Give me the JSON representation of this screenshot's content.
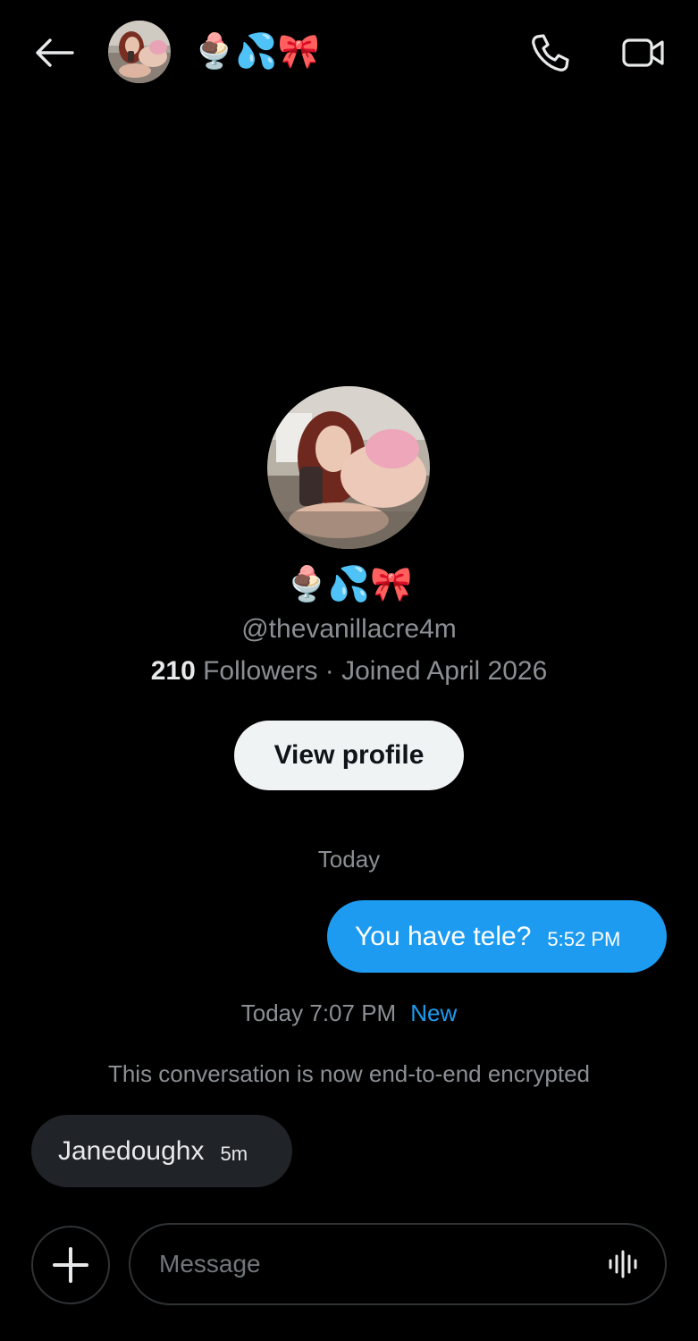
{
  "header": {
    "back_icon": "arrow-left-icon",
    "display_name": "🍨💦🎀",
    "call_icon": "phone-icon",
    "video_icon": "video-camera-icon"
  },
  "profile": {
    "display_name": "🍨💦🎀",
    "handle": "@thevanillacre4m",
    "followers_count": "210",
    "followers_label": " Followers · Joined April 2026",
    "view_profile_label": "View profile"
  },
  "conversation": {
    "day_label": "Today",
    "messages": [
      {
        "direction": "sent",
        "text": "You have tele?",
        "time": "5:52 PM"
      },
      {
        "direction": "received",
        "text": "Janedoughx",
        "time": "5m"
      }
    ],
    "new_timestamp": "Today 7:07 PM",
    "new_label": "New",
    "encrypted_notice": "This conversation is now end-to-end encrypted"
  },
  "composer": {
    "add_icon": "plus-icon",
    "placeholder": "Message",
    "voice_icon": "voice-waveform-icon"
  },
  "colors": {
    "background": "#000000",
    "accent": "#1d9bf0",
    "received_bubble": "#202327",
    "muted_text": "#8b8f94"
  }
}
